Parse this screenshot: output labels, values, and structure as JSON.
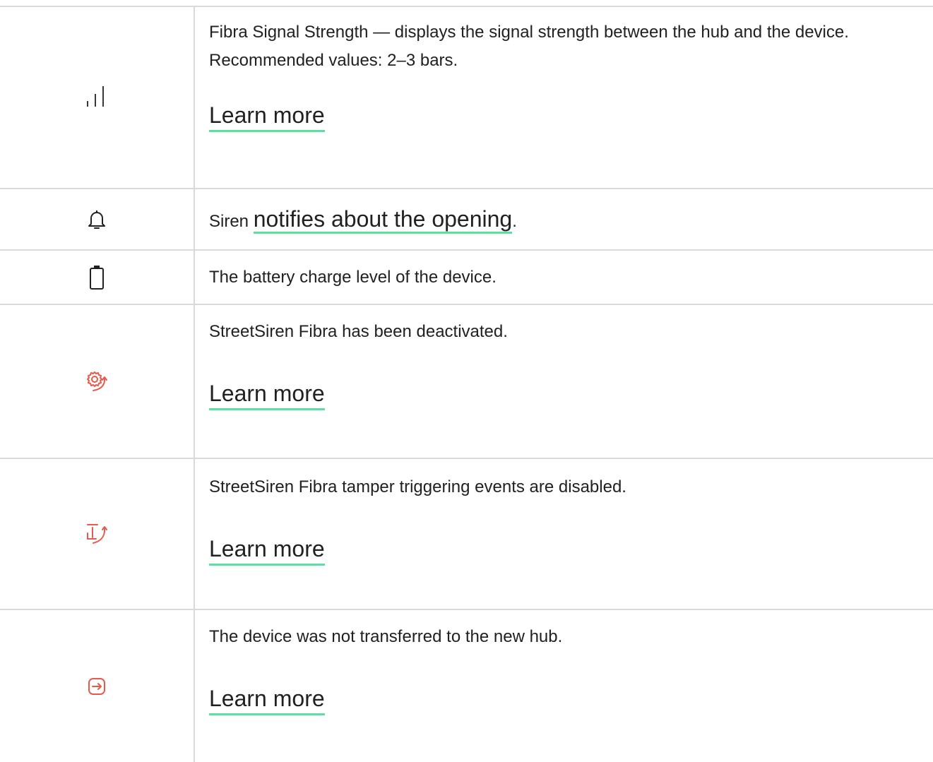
{
  "rows": [
    {
      "icon": "signal-bars-icon",
      "text": "Fibra Signal Strength — displays the signal strength between the hub and the device. Recommended values: 2–3 bars.",
      "link": "Learn more"
    },
    {
      "icon": "bell-icon",
      "prefix": "Siren ",
      "link": "notifies about the opening",
      "suffix": "."
    },
    {
      "icon": "battery-icon",
      "text": "The battery charge level of the device."
    },
    {
      "icon": "gear-deactivated-icon",
      "text": "StreetSiren Fibra has been deactivated.",
      "link": "Learn more"
    },
    {
      "icon": "tamper-disabled-icon",
      "text": "StreetSiren Fibra tamper triggering events are disabled.",
      "link": "Learn more"
    },
    {
      "icon": "transfer-icon",
      "text": "The device was not transferred to the new hub.",
      "link": "Learn more"
    }
  ],
  "colors": {
    "accent_underline": "#5ddfa3",
    "icon_red": "#e8594a",
    "grid": "#d9d9d9",
    "text": "#212121"
  }
}
